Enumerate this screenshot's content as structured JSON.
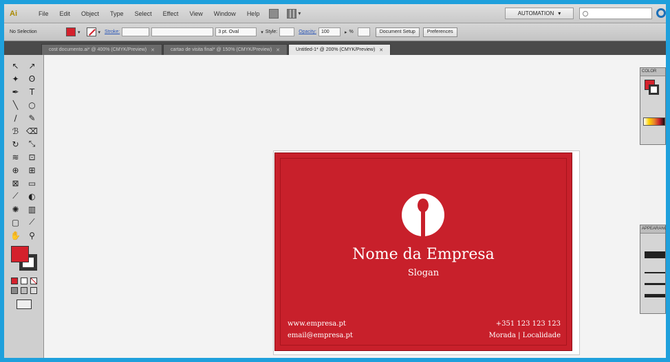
{
  "menu": {
    "logo": "Ai",
    "items": [
      "File",
      "Edit",
      "Object",
      "Type",
      "Select",
      "Effect",
      "View",
      "Window",
      "Help"
    ],
    "workspace": "AUTOMATION"
  },
  "control": {
    "selection": "No Selection",
    "stroke_label": "Stroke:",
    "brush": "3 pt. Oval",
    "style_label": "Style:",
    "opacity_label": "Opacity:",
    "opacity_value": "100",
    "opacity_unit": "%",
    "document_setup": "Document Setup",
    "preferences": "Preferences"
  },
  "tabs": [
    {
      "label": "cost documento.ai* @ 400% (CMYK/Preview)"
    },
    {
      "label": "cartao de visita final* @ 150% (CMYK/Preview)"
    },
    {
      "label": "Untitled-1* @ 200% (CMYK/Preview)"
    }
  ],
  "card": {
    "company": "Nome da Empresa",
    "slogan": "Slogan",
    "website": "www.empresa.pt",
    "email": "email@empresa.pt",
    "phone": "+351 123 123 123",
    "address": "Morada | Localidade"
  },
  "panels": {
    "color_title": "COLOR",
    "stroke_title": "APPEARANCE"
  },
  "colors": {
    "accent": "#c8202b",
    "frame": "#1fa0dc"
  }
}
